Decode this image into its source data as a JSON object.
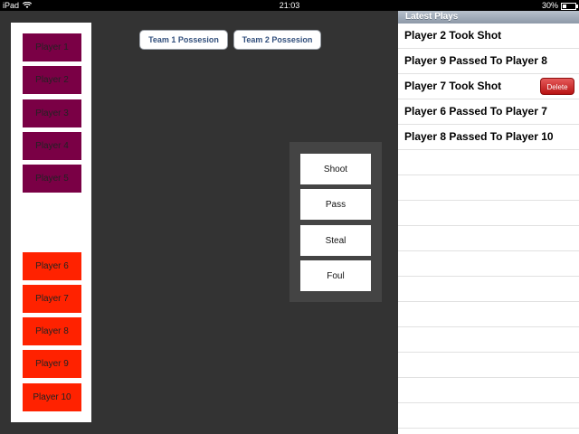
{
  "status_bar": {
    "device": "iPad",
    "time": "21:03",
    "battery": "30%",
    "battery_level": 0.3
  },
  "team1_players": [
    "Player 1",
    "Player 2",
    "Player 3",
    "Player 4",
    "Player 5"
  ],
  "team2_players": [
    "Player 6",
    "Player 7",
    "Player 8",
    "Player 9",
    "Player 10"
  ],
  "possession": {
    "team1_label": "Team 1 Possesion",
    "team2_label": "Team 2 Possesion"
  },
  "actions": [
    "Shoot",
    "Pass",
    "Steal",
    "Foul"
  ],
  "plays": {
    "header": "Latest Plays",
    "items": [
      "Player 2 Took Shot",
      "Player 9 Passed To Player 8",
      "Player 7 Took Shot",
      "Player 6 Passed To Player 7",
      "Player 8 Passed To Player 10"
    ],
    "delete_label": "Delete"
  },
  "colors": {
    "team1": "#7a0045",
    "team2": "#ff2200",
    "background": "#333333"
  }
}
